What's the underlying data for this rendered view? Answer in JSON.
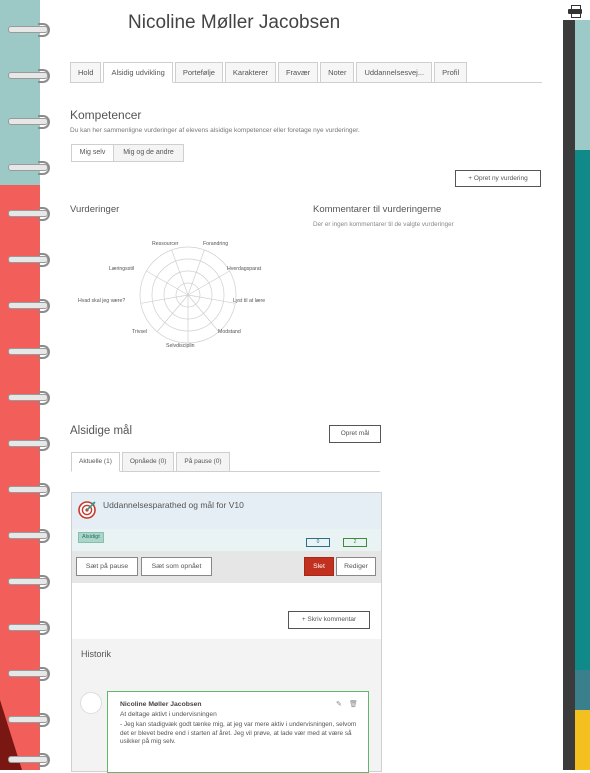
{
  "student": {
    "name": "Nicoline Møller Jacobsen"
  },
  "tabs": [
    {
      "label": "Hold"
    },
    {
      "label": "Alsidig udvikling"
    },
    {
      "label": "Portefølje"
    },
    {
      "label": "Karakterer"
    },
    {
      "label": "Fravær"
    },
    {
      "label": "Noter"
    },
    {
      "label": "Uddannelsesvej..."
    },
    {
      "label": "Profil"
    }
  ],
  "active_tab": "Alsidig udvikling",
  "kompetencer": {
    "title": "Kompetencer",
    "subtitle": "Du kan her sammenligne vurderinger af elevens alsidige kompetencer eller foretage nye vurderinger.",
    "segment_self": "Mig selv",
    "segment_others": "Mig og de andre",
    "create_button": "+ Opret ny vurdering"
  },
  "vurderinger": {
    "title": "Vurderinger",
    "radar_labels": [
      "Ressourcer",
      "Forandring",
      "Hverdagsparat",
      "Lyst til at lære",
      "Modstand",
      "Selvdisciplin",
      "Trivsel",
      "Hvad skal jeg være?",
      "Læringsstil"
    ]
  },
  "kommentarer": {
    "title": "Kommentarer til vurderingerne",
    "empty": "Der er ingen kommentarer til de valgte vurderinger"
  },
  "goals": {
    "title": "Alsidige mål",
    "create_button": "Opret mål",
    "tabs": [
      {
        "label": "Aktuelle (1)"
      },
      {
        "label": "Opnåede (0)"
      },
      {
        "label": "På pause (0)"
      }
    ]
  },
  "goal_card": {
    "title": "Uddannelsesparathed og mål for V10",
    "tag": "Alsidigt",
    "count_blue": "0",
    "count_green": "2",
    "btn_pause": "Sæt på pause",
    "btn_achieved": "Sæt som opnået",
    "btn_delete": "Slet",
    "btn_edit": "Rediger",
    "btn_comment": "+ Skriv kommentar",
    "history_title": "Historik",
    "comment": {
      "author": "Nicoline Møller Jacobsen",
      "goal": "At deltage aktivt i undervisningen",
      "text": "- Jeg kan stadigvæk godt tænke mig, at jeg var mere aktiv i undervisningen, selvom det er blevet bedre end i starten af året. Jeg vil prøve, at lade vær med at være så usikker på mig selv."
    }
  },
  "colors": {
    "strip_teal": "#9cc9c6",
    "strip_red": "#f25f5a",
    "delete_red": "#c2311f",
    "comment_border": "#63b56a"
  }
}
